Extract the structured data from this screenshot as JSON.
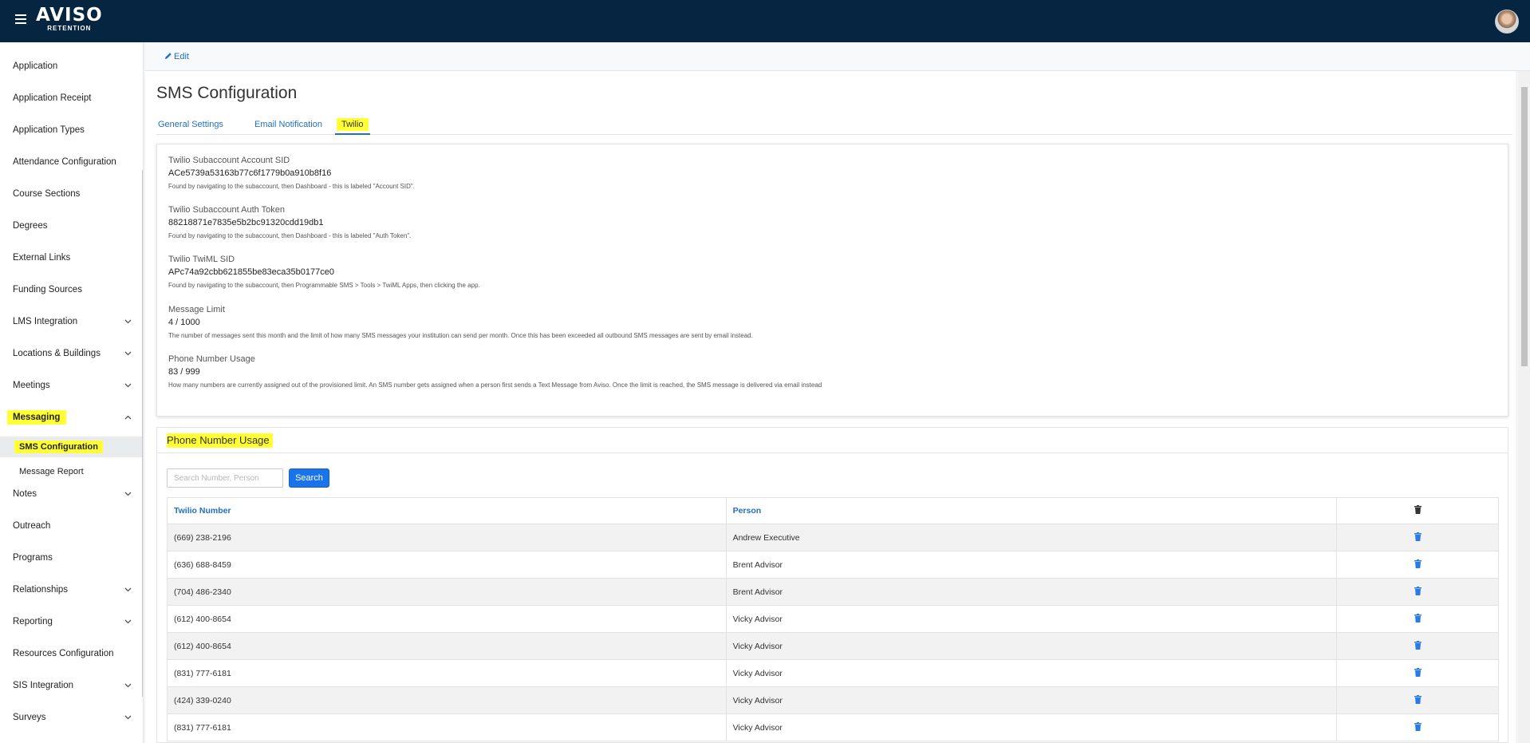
{
  "brand": {
    "name": "AVISO",
    "tagline": "RETENTION"
  },
  "toolbar": {
    "edit_label": "Edit"
  },
  "sidebar": {
    "items": [
      {
        "label": "Application"
      },
      {
        "label": "Application Receipt"
      },
      {
        "label": "Application Types"
      },
      {
        "label": "Attendance Configuration"
      },
      {
        "label": "Course Sections"
      },
      {
        "label": "Degrees"
      },
      {
        "label": "External Links"
      },
      {
        "label": "Funding Sources"
      },
      {
        "label": "LMS Integration"
      },
      {
        "label": "Locations & Buildings"
      },
      {
        "label": "Meetings"
      },
      {
        "label": "Messaging"
      },
      {
        "label": "SMS Configuration"
      },
      {
        "label": "Message Report"
      },
      {
        "label": "Notes"
      },
      {
        "label": "Outreach"
      },
      {
        "label": "Programs"
      },
      {
        "label": "Relationships"
      },
      {
        "label": "Reporting"
      },
      {
        "label": "Resources Configuration"
      },
      {
        "label": "SIS Integration"
      },
      {
        "label": "Surveys"
      }
    ]
  },
  "page": {
    "title": "SMS Configuration",
    "tabs": [
      {
        "label": "General Settings"
      },
      {
        "label": "Email Notification"
      },
      {
        "label": "Twilio"
      }
    ]
  },
  "fields": [
    {
      "label": "Twilio Subaccount Account SID",
      "value": "ACe5739a53163b77c6f1779b0a910b8f16",
      "help": " Found by navigating to the subaccount, then Dashboard - this is labeled \"Account SID\"."
    },
    {
      "label": "Twilio Subaccount Auth Token",
      "value": "88218871e7835e5b2bc91320cdd19db1",
      "help": "Found by navigating to the subaccount, then Dashboard - this is labeled \"Auth Token\"."
    },
    {
      "label": "Twilio TwiML SID",
      "value": "APc74a92cbb621855be83eca35b0177ce0",
      "help": " Found by navigating to the subaccount, then Programmable SMS > Tools > TwiML Apps, then clicking the app."
    },
    {
      "label": "Message Limit",
      "value": "4 / 1000",
      "help": "The number of messages sent this month and the limit of how many SMS messages your institution can send per month. Once this has been exceeded all outbound SMS messages are sent by email instead."
    },
    {
      "label": "Phone Number Usage",
      "value": "83 / 999",
      "help": "How many numbers are currently assigned out of the provisioned limit. An SMS number gets assigned when a person first sends a Text Message from Aviso. Once the limit is reached, the SMS message is delivered via email instead"
    }
  ],
  "usage": {
    "title": "Phone Number Usage",
    "search_placeholder": "Search Number, Person",
    "search_label": "Search",
    "columns": {
      "number": "Twilio Number",
      "person": "Person"
    },
    "rows": [
      {
        "number": "(669) 238-2196",
        "person": "Andrew Executive"
      },
      {
        "number": "(636) 688-8459",
        "person": "Brent Advisor"
      },
      {
        "number": "(704) 486-2340",
        "person": "Brent Advisor"
      },
      {
        "number": "(612) 400-8654",
        "person": "Vicky Advisor"
      },
      {
        "number": "(612) 400-8654",
        "person": "Vicky Advisor"
      },
      {
        "number": "(831) 777-6181",
        "person": "Vicky Advisor"
      },
      {
        "number": "(424) 339-0240",
        "person": "Vicky Advisor"
      },
      {
        "number": "(831) 777-6181",
        "person": "Vicky Advisor"
      }
    ]
  },
  "colors": {
    "topbar": "#062541",
    "accent": "#1f6fc5",
    "button": "#1a73e8",
    "highlight": "#ffff33"
  }
}
